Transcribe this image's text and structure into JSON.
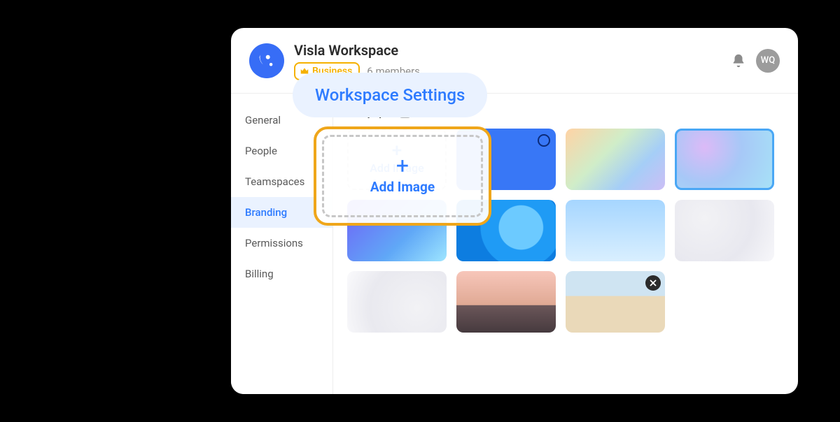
{
  "header": {
    "title": "Visla Workspace",
    "plan_label": "Business",
    "members_label": "6 members",
    "avatar_initials": "WQ"
  },
  "popover": {
    "title": "Workspace Settings"
  },
  "sidebar": {
    "items": [
      {
        "label": "General"
      },
      {
        "label": "People"
      },
      {
        "label": "Teamspaces"
      },
      {
        "label": "Branding",
        "active": true
      },
      {
        "label": "Permissions"
      },
      {
        "label": "Billing"
      }
    ]
  },
  "content": {
    "section_title": "Wallpaper",
    "add_image_label": "Add Image"
  },
  "colors": {
    "accent": "#2e7bff",
    "brand_blue": "#376df6",
    "highlight_outline": "#efa61a",
    "plan_badge": "#f5b100"
  }
}
